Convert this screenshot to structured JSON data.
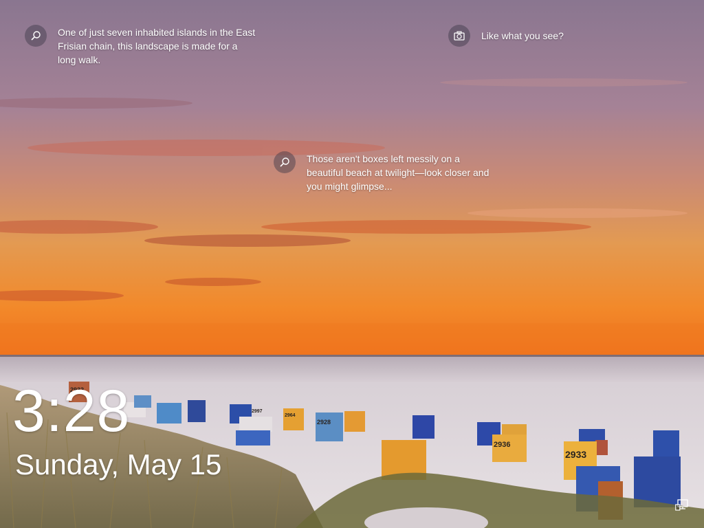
{
  "lock_screen": {
    "hotspots": [
      {
        "icon": "search-icon",
        "text": "One of just seven inhabited islands in the East Frisian chain, this landscape is made for a long walk."
      },
      {
        "icon": "camera-icon",
        "text": "Like what you see?"
      },
      {
        "icon": "search-icon",
        "text": "Those aren't boxes left messily on a beautiful beach at twilight—look closer and you might glimpse..."
      }
    ],
    "time": "3:28",
    "date": "Sunday, May 15",
    "status_icon": "network-icon"
  },
  "beach_chair_numbers": [
    "2932",
    "2933",
    "2936",
    "2928",
    "2964",
    "2997"
  ],
  "colors": {
    "sky_top": "#8d7890",
    "sky_mid": "#c8856a",
    "horizon": "#f07a1e",
    "sea": "#cfc7cc",
    "sand": "#ddd6dc",
    "grass": "#7a6a3c"
  }
}
